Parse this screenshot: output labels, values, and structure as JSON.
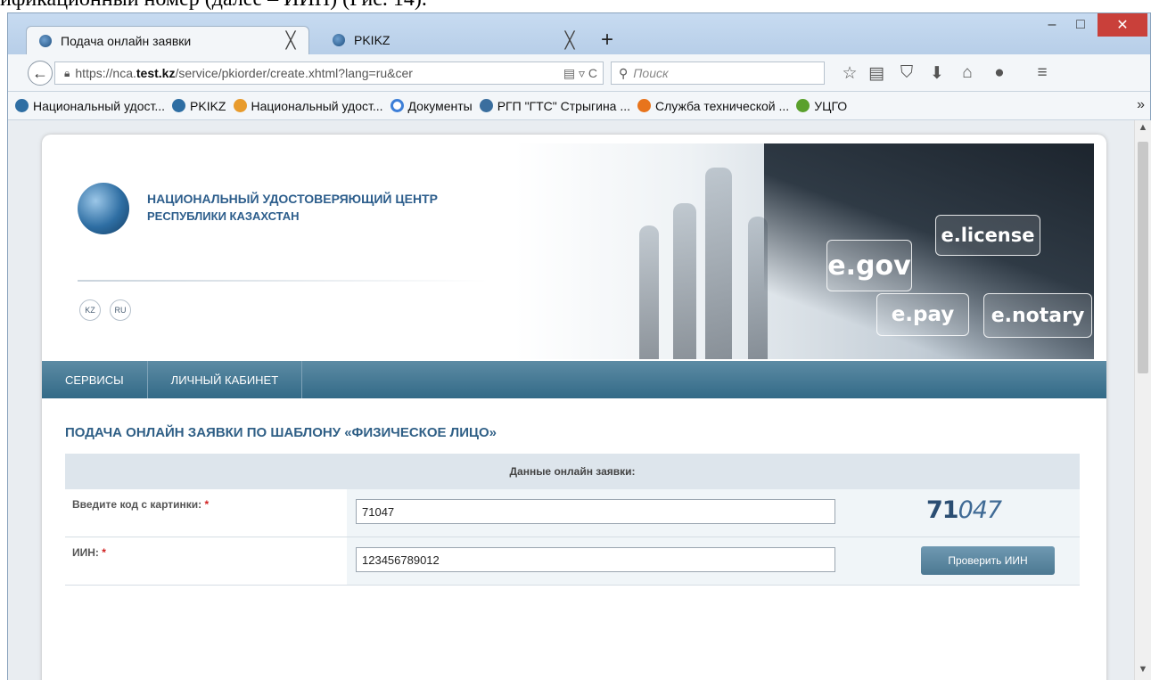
{
  "document": {
    "fragment_text": "ификационный номер (далее – ИИН) (Рис. 14)."
  },
  "window": {
    "minimize": "–",
    "maximize": "□",
    "close": "✕"
  },
  "tabs": [
    {
      "label": "Подача онлайн заявки",
      "close": "╳",
      "favicon": "globe-icon"
    },
    {
      "label": "PKIKZ",
      "close": "╳",
      "favicon": "globe-icon"
    }
  ],
  "new_tab": "+",
  "address_bar": {
    "prefix": "https://nca.",
    "domain": "test.kz",
    "suffix": "/service/pkiorder/create.xhtml?lang=ru&cer",
    "icons": "▤ ▿ C"
  },
  "search": {
    "placeholder": "Поиск"
  },
  "bookmarks": [
    {
      "label": "Национальный удост...",
      "color": "#2e6ea3"
    },
    {
      "label": "PKIKZ",
      "color": "#2e6ea3"
    },
    {
      "label": "Национальный удост...",
      "color": "#e89b2c"
    },
    {
      "label": "Документы",
      "color": "#3d7fd8"
    },
    {
      "label": "РГП \"ГТС\" Стрыгина ...",
      "color": "#3a6e9e"
    },
    {
      "label": "Служба технической ...",
      "color": "#e8741c"
    },
    {
      "label": "УЦГО",
      "color": "#5aa02c"
    }
  ],
  "bookmarks_more": "»",
  "site": {
    "org_line1": "НАЦИОНАЛЬНЫЙ УДОСТОВЕРЯЮЩИЙ ЦЕНТР",
    "org_line2": "РЕСПУБЛИКИ КАЗАХСТАН",
    "lang_kz": "KZ",
    "lang_ru": "RU",
    "banner_badges": [
      "e.license",
      "e.gov",
      "e.pay",
      "e.notary"
    ],
    "menu": [
      "СЕРВИСЫ",
      "ЛИЧНЫЙ КАБИНЕТ"
    ],
    "form_title": "ПОДАЧА ОНЛАЙН ЗАЯВКИ ПО ШАБЛОНУ «ФИЗИЧЕСКОЕ ЛИЦО»",
    "table_header": "Данные онлайн заявки:",
    "captcha_label": "Введите код с картинки:",
    "captcha_value": "71047",
    "captcha_image_bold": "71",
    "captcha_image_italic": "047",
    "iin_label": "ИИН:",
    "iin_value": "123456789012",
    "required_mark": "*",
    "check_button": "Проверить ИИН"
  },
  "colors": {
    "accent": "#2d5e8c",
    "menu": "#336a87",
    "close": "#c9403a"
  }
}
